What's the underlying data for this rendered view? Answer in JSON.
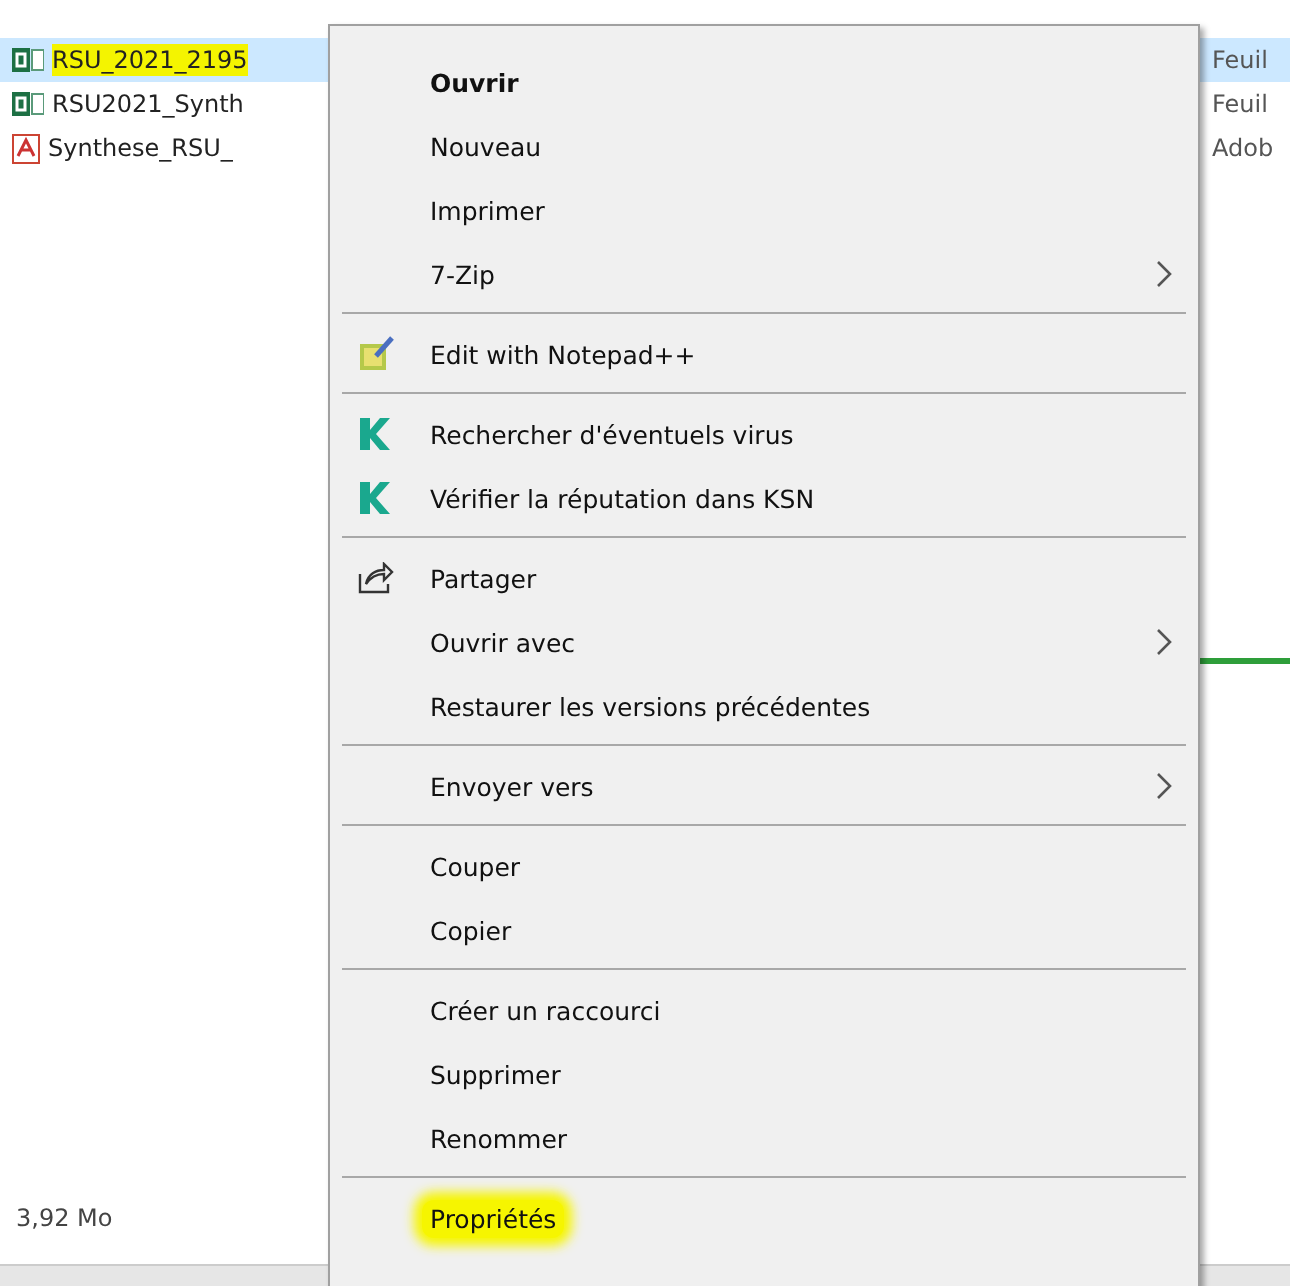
{
  "files": [
    {
      "name": "RSU_2021_2195",
      "type": "Feuil",
      "kind": "spreadsheet",
      "selected": true,
      "highlighted": true
    },
    {
      "name": "RSU2021_Synth",
      "type": "Feuil",
      "kind": "spreadsheet",
      "selected": false,
      "highlighted": false
    },
    {
      "name": "Synthese_RSU_",
      "type": "Adob",
      "kind": "pdf",
      "selected": false,
      "highlighted": false
    }
  ],
  "status_bar": {
    "size": "3,92 Mo"
  },
  "context_menu": {
    "groups": [
      [
        {
          "label": "Ouvrir",
          "default": true
        },
        {
          "label": "Nouveau"
        },
        {
          "label": "Imprimer"
        },
        {
          "label": "7-Zip",
          "submenu": true
        }
      ],
      [
        {
          "label": "Edit with Notepad++",
          "kind": "notepad"
        }
      ],
      [
        {
          "label": "Rechercher d'éventuels virus",
          "kind": "k"
        },
        {
          "label": "Vérifier la réputation dans KSN",
          "kind": "k"
        }
      ],
      [
        {
          "label": "Partager",
          "kind": "share"
        },
        {
          "label": "Ouvrir avec",
          "submenu": true
        },
        {
          "label": "Restaurer les versions précédentes"
        }
      ],
      [
        {
          "label": "Envoyer vers",
          "submenu": true
        }
      ],
      [
        {
          "label": "Couper"
        },
        {
          "label": "Copier"
        }
      ],
      [
        {
          "label": "Créer un raccourci"
        },
        {
          "label": "Supprimer"
        },
        {
          "label": "Renommer"
        }
      ],
      [
        {
          "label": "Propriétés",
          "highlighted": true
        }
      ]
    ]
  }
}
